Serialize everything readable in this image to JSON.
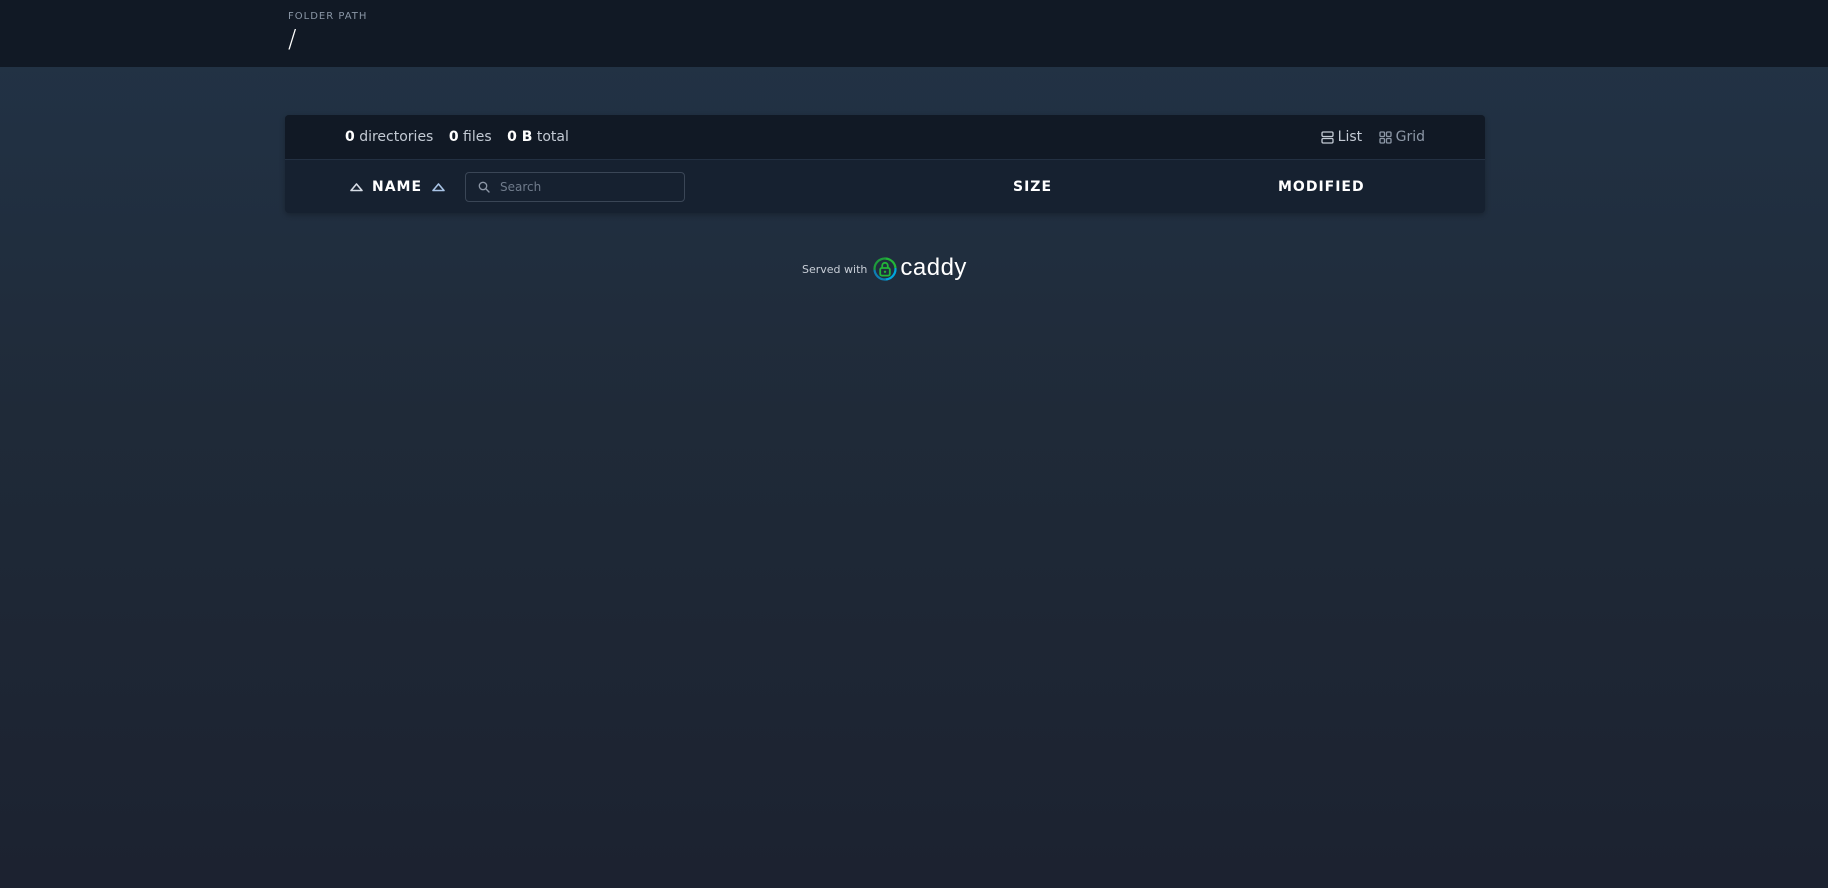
{
  "header": {
    "label": "FOLDER PATH",
    "path": "/"
  },
  "summary": {
    "directories_count": "0",
    "directories_label": "directories",
    "files_count": "0",
    "files_label": "files",
    "size_value": "0 B",
    "size_label": "total"
  },
  "layout": {
    "list_label": "List",
    "grid_label": "Grid"
  },
  "columns": {
    "name": "NAME",
    "size": "SIZE",
    "modified": "MODIFIED"
  },
  "search": {
    "placeholder": "Search"
  },
  "footer": {
    "served_with": "Served with",
    "brand": "caddy"
  },
  "colors": {
    "header_bg": "#111925",
    "panel_bg": "#162130",
    "text": "#d7dde6",
    "accent_sort_arrow": "#a9c4e6",
    "caddy_green": "#22b638",
    "caddy_blue": "#00a6dd"
  }
}
